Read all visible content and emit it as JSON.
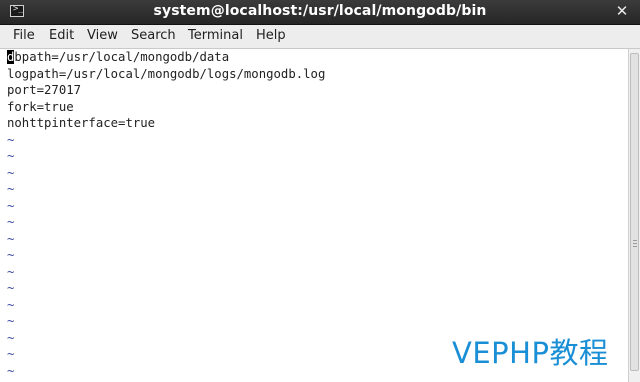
{
  "window": {
    "title": "system@localhost:/usr/local/mongodb/bin",
    "close_glyph": "✕",
    "icon_glyph": ">_"
  },
  "menu": {
    "items": [
      "File",
      "Edit",
      "View",
      "Search",
      "Terminal",
      "Help"
    ]
  },
  "editor": {
    "cursor_char": "d",
    "first_line_rest": "bpath=/usr/local/mongodb/data",
    "lines": [
      "logpath=/usr/local/mongodb/logs/mongodb.log",
      "port=27017",
      "fork=true",
      "nohttpinterface=true"
    ],
    "empty_marker": "~",
    "empty_line_count": 15
  },
  "watermark": {
    "text": "VEPHP教程"
  },
  "colors": {
    "titlebar": "#2e2e2e",
    "menubar": "#ededed",
    "tilde": "#3a4aa0",
    "watermark": "#1a8fd6"
  }
}
